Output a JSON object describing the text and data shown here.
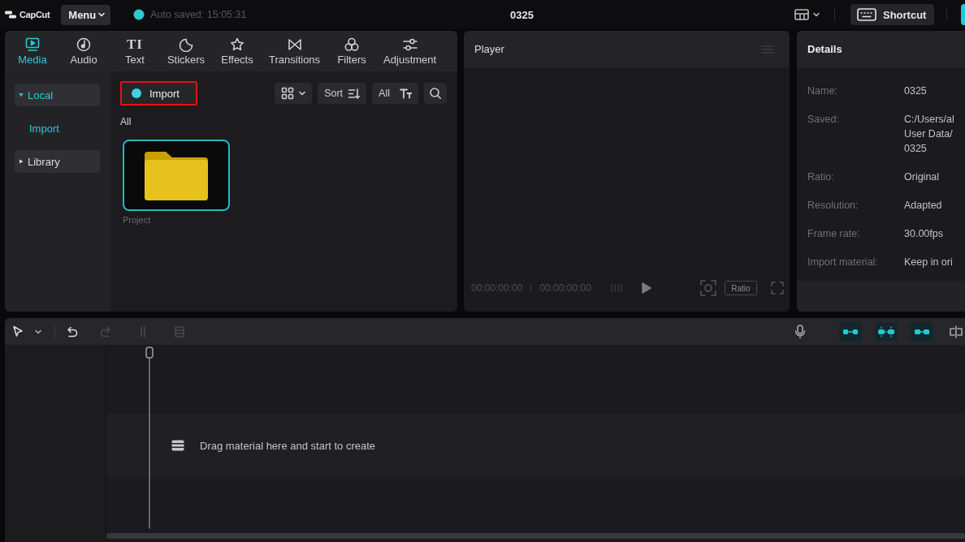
{
  "app_bar": {
    "logo": "CapCut",
    "menu": "Menu",
    "autosave": "Auto saved: 15:05:31",
    "project_title": "0325",
    "shortcut": "Shortcut"
  },
  "media_panel": {
    "tabs": [
      {
        "label": "Media",
        "selected": true
      },
      {
        "label": "Audio",
        "selected": false
      },
      {
        "label": "Text",
        "selected": false,
        "glyph": "TI"
      },
      {
        "label": "Stickers",
        "selected": false
      },
      {
        "label": "Effects",
        "selected": false
      },
      {
        "label": "Transitions",
        "selected": false
      },
      {
        "label": "Filters",
        "selected": false
      },
      {
        "label": "Adjustment",
        "selected": false
      }
    ],
    "sidebar": [
      {
        "label": "Local",
        "selected": true,
        "expanded": true,
        "children": [
          {
            "label": "Import",
            "selected": true
          }
        ]
      },
      {
        "label": "Library",
        "selected": false,
        "expanded": false
      }
    ],
    "import_button": {
      "label": "Import",
      "highlighted": true
    },
    "sort_button": "Sort",
    "filter_button": "All",
    "section": "All",
    "items": [
      {
        "name": "Project",
        "selected": true
      }
    ]
  },
  "player": {
    "title": "Player",
    "current_time": "00:00:00:00",
    "duration": "00:00:00:00",
    "ratio_button": "Ratio"
  },
  "details": {
    "title": "Details",
    "fields": [
      {
        "label": "Name:",
        "value": [
          "0325"
        ]
      },
      {
        "label": "Saved:",
        "value": [
          "C:/Users/al",
          "User Data/",
          "0325"
        ]
      },
      {
        "label": "Ratio:",
        "value": [
          "Original"
        ]
      },
      {
        "label": "Resolution:",
        "value": [
          "Adapted"
        ]
      },
      {
        "label": "Frame rate:",
        "value": [
          "30.00fps"
        ]
      },
      {
        "label": "Import material:",
        "value": [
          "Keep in ori"
        ]
      }
    ]
  },
  "timeline": {
    "left_tools": [
      {
        "disabled": false
      },
      {
        "disabled": false
      },
      {
        "disabled": true
      },
      {
        "disabled": true
      },
      {
        "disabled": true
      }
    ],
    "right_tools": [
      {
        "on": false
      },
      {
        "on": true
      },
      {
        "on": true
      },
      {
        "on": true
      },
      {
        "on": false
      }
    ],
    "hint": "Drag material here and start to create"
  }
}
